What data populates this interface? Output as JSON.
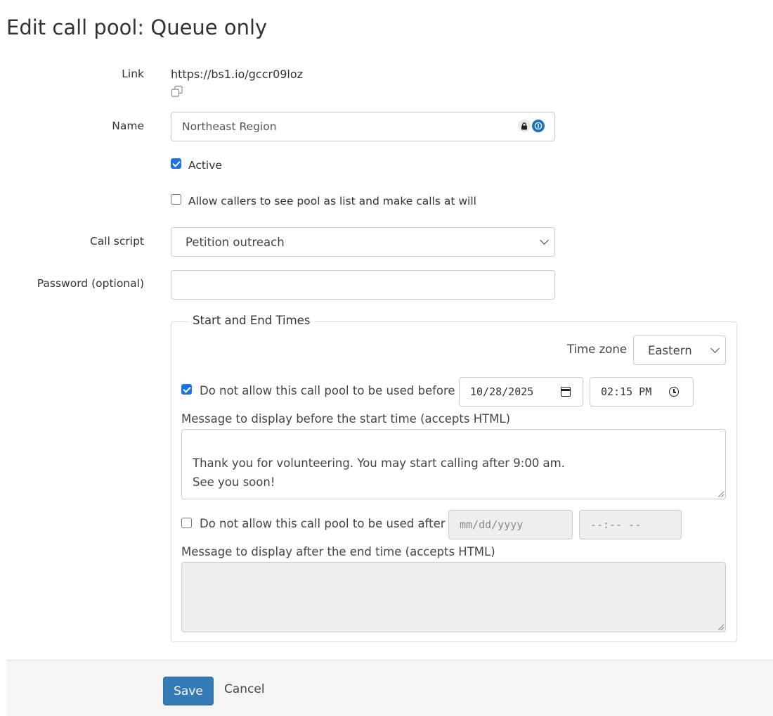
{
  "page": {
    "title": "Edit call pool: Queue only"
  },
  "form": {
    "link": {
      "label": "Link",
      "value": "https://bs1.io/gccr09loz"
    },
    "name": {
      "label": "Name",
      "value": "Northeast Region"
    },
    "active": {
      "label": "Active",
      "checked": true
    },
    "allow_list": {
      "label": "Allow callers to see pool as list and make calls at will",
      "checked": false
    },
    "call_script": {
      "label": "Call script",
      "selected": "Petition outreach"
    },
    "password": {
      "label": "Password (optional)",
      "value": ""
    }
  },
  "times": {
    "legend": "Start and End Times",
    "timezone": {
      "label": "Time zone",
      "selected": "Eastern"
    },
    "before": {
      "checked": true,
      "label": "Do not allow this call pool to be used before",
      "date": "10/28/2025",
      "time": "02:15 PM",
      "message_label": "Message to display before the start time (accepts HTML)",
      "message": "Thank you for volunteering. You may start calling after 9:00 am.\nSee you soon!"
    },
    "after": {
      "checked": false,
      "label": "Do not allow this call pool to be used after",
      "date_placeholder": "mm/dd/yyyy",
      "time_placeholder": "--:-- --",
      "message_label": "Message to display after the end time (accepts HTML)",
      "message": ""
    }
  },
  "footer": {
    "save_label": "Save",
    "cancel_label": "Cancel"
  },
  "colors": {
    "primary": "#337ab7",
    "checkbox": "#1a73e8",
    "disabled_bg": "#eeeeee"
  }
}
